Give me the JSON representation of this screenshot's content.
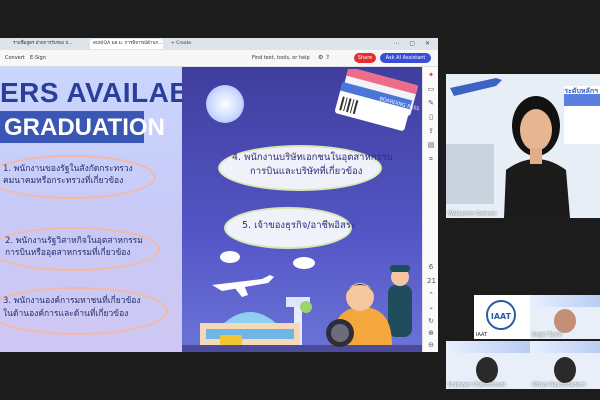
{
  "browser": {
    "tabs": [
      {
        "label": "รายชื่อผู้สนใจ"
      },
      {
        "label": "รายชื่อสูตร ฝ่ายการรับรอง ป..."
      },
      {
        "label": "สปฟ(QA มส.ม. การพิจารณ์ด้านก..."
      },
      {
        "label": "+ Create"
      }
    ],
    "window_controls": "⋯ ▢ ✕"
  },
  "toolbar": {
    "convert": "Convert",
    "esign": "E-Sign",
    "find": "Find text, tools, or help",
    "share": "Share",
    "ai_assistant": "Ask AI Assistant"
  },
  "slide": {
    "headline_line1": "ERS AVAILABLE",
    "headline_line2": "GRADUATION",
    "left_items": [
      {
        "line1": "1. พนักงานของรัฐในสังกัดกระทรวง",
        "line2": "คมนาคมหรือกระทรวงที่เกี่ยวข้อง"
      },
      {
        "line1": "2. พนักงานรัฐวิสาหกิจในอุตสาหกรรม",
        "line2": "การบินหรืออุตสาหกรรมที่เกี่ยวข้อง"
      },
      {
        "line1": "3. พนักงานองค์การมหาชนที่เกี่ยวข้อง",
        "line2": "ในด้านองค์การและด้านที่เกี่ยวข้อง"
      }
    ],
    "right_items": [
      {
        "line1": "4. พนักงานบริษัทเอกชนในอุตสาหกรรม",
        "line2": "การบินและบริษัทที่เกี่ยวข้อง"
      },
      {
        "line1": "5. เจ้าของธุรกิจ/อาชีพอิสระ",
        "line2": ""
      }
    ],
    "ticket_label": "BOARDING PASS"
  },
  "colors": {
    "accent_red": "#e62e2e",
    "accent_blue": "#3a4dd6",
    "slide_dark": "#3f3e9e"
  },
  "participants": {
    "speaker": "Watsamon Samnan",
    "p1": "IAAT",
    "p2": "Angie Taylor",
    "p3": "Onjirayer Chanchonyot",
    "p4": "Kittiya Nasonthadech"
  },
  "logo_text": "IAAT",
  "banner_text": "ระดับหลักฯ"
}
